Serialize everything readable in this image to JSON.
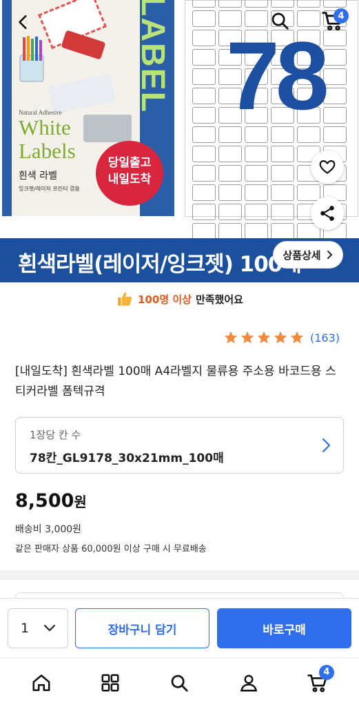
{
  "header": {
    "cart_badge": "4"
  },
  "hero": {
    "package": {
      "vertical_text": "LABEL",
      "subtitle_small": "Natural Adhesive",
      "brand_line1": "White",
      "brand_line2": "Labels",
      "korean_name": "흰색 라벨",
      "printer_note": "잉크젯/레이저 프린터 겸용",
      "badge_line1": "당일출고",
      "badge_line2": "내일도착"
    },
    "sheet_number": "78"
  },
  "banner": {
    "title": "흰색라벨(레이저/잉크젯) 100매",
    "detail_button": "상품상세"
  },
  "satisfaction": {
    "highlight": "100명 이상",
    "text": "만족했어요"
  },
  "rating": {
    "stars": 5,
    "count": "(163)"
  },
  "product": {
    "title": "[내일도착] 흰색라벨 100매 A4라벨지 물류용 주소용 바코드용 스티커라벨 폼텍규격"
  },
  "option": {
    "label": "1장당 칸 수",
    "value": "78칸_GL9178_30x21mm_100매"
  },
  "price": {
    "amount": "8,500",
    "currency": "원",
    "shipping": "배송비 3,000원",
    "free_shipping": "같은 판매자 상품 60,000원 이상 구매 시 무료배송"
  },
  "purchase": {
    "quantity": "1",
    "cart_button": "장바구니 담기",
    "buy_button": "바로구매"
  },
  "nav": {
    "cart_badge": "4"
  },
  "colors": {
    "accent": "#2f6fec",
    "banner": "#1c4f9c",
    "star": "#f08a3c",
    "highlight": "#e05a1c",
    "badge_red": "#d7263d"
  }
}
